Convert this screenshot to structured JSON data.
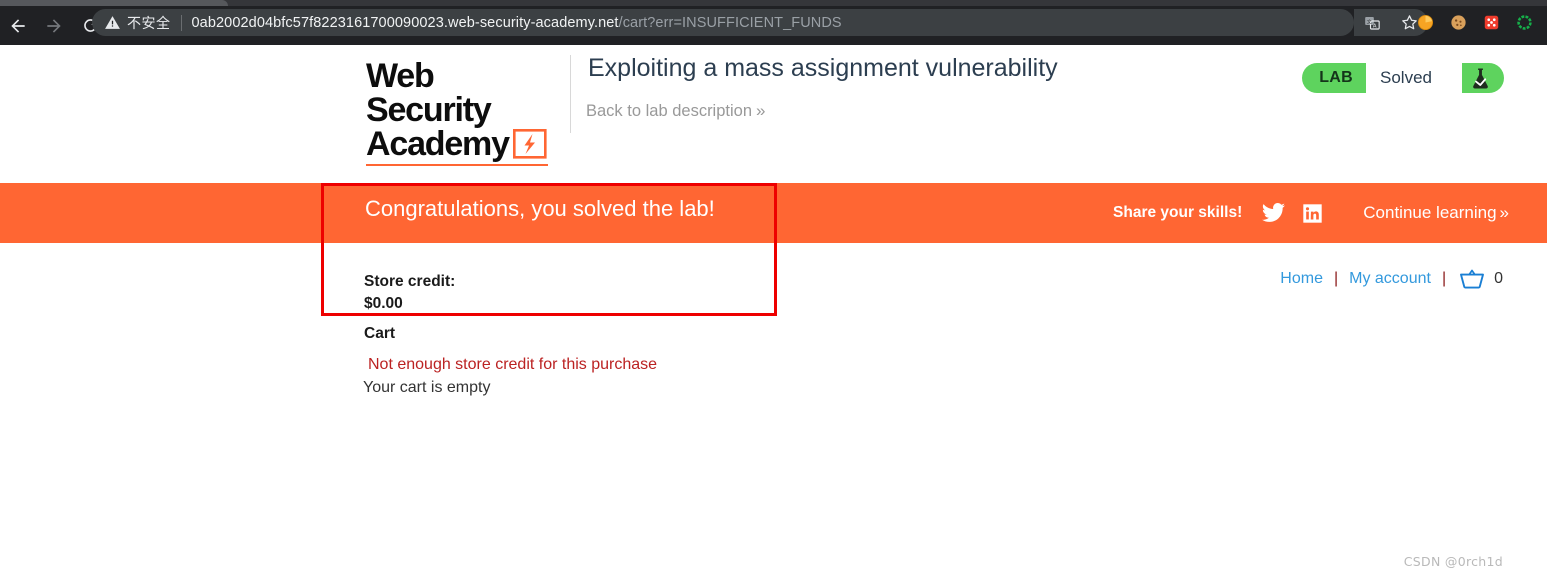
{
  "browser": {
    "back_icon": "back-arrow-icon",
    "forward_icon": "forward-arrow-icon",
    "reload_icon": "reload-icon",
    "security_status": "不安全",
    "security_icon": "warning-triangle-icon",
    "url_host": "0ab2002d04bfc57f8223161700090023.web-security-academy.net",
    "url_path": "/cart?err=INSUFFICIENT_FUNDS",
    "toolbar_icons": [
      "translate-icon",
      "bookmark-star-icon",
      "extension-orange-icon",
      "extension-cookie-icon",
      "extension-dice-icon",
      "extension-green-ring-icon"
    ]
  },
  "header": {
    "logo_line1": "Web Security",
    "logo_line2": "Academy",
    "logo_bolt_icon": "lightning-bolt-icon",
    "lab_title": "Exploiting a mass assignment vulnerability",
    "back_link": "Back to lab description",
    "back_link_chevron": "»",
    "status": {
      "tag": "LAB",
      "state": "Solved",
      "flask_icon": "flask-check-icon",
      "color": "#5ed35e"
    }
  },
  "banner": {
    "congrats": "Congratulations, you solved the lab!",
    "share_label": "Share your skills!",
    "twitter_icon": "twitter-bird-icon",
    "linkedin_icon": "linkedin-icon",
    "continue_label": "Continue learning",
    "continue_chevron": "»",
    "background": "#ff6633"
  },
  "shop": {
    "nav": {
      "home": "Home",
      "my_account": "My account",
      "separator": "|",
      "basket_icon": "shopping-basket-icon",
      "basket_count": "0"
    },
    "store_credit_label": "Store credit:",
    "store_credit_amount": "$0.00",
    "cart_heading": "Cart",
    "cart_error": "Not enough store credit for this purchase",
    "cart_empty": "Your cart is empty"
  },
  "annotation": {
    "color": "#ee0000"
  },
  "watermark": "CSDN @0rch1d"
}
